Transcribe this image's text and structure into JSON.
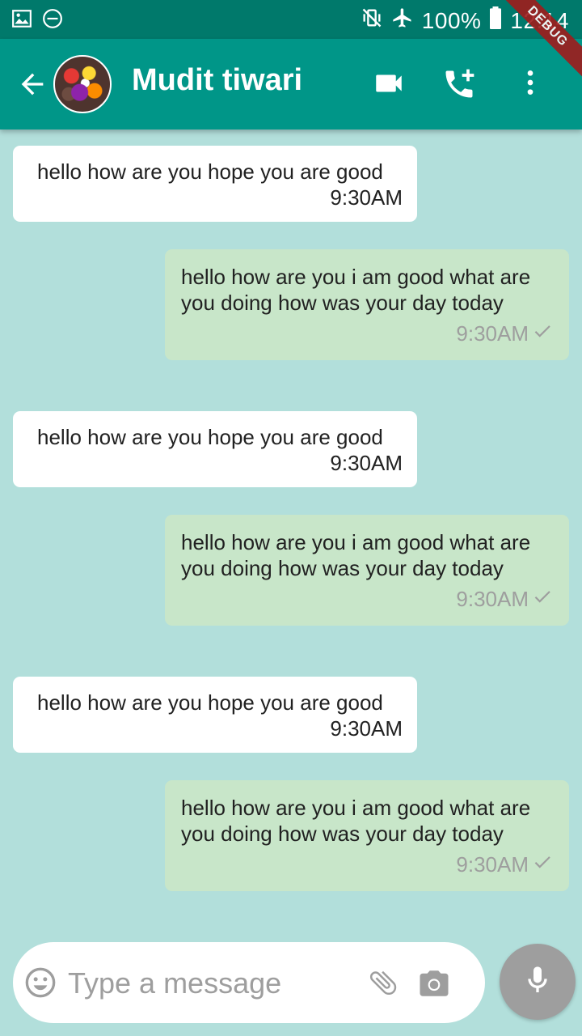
{
  "status_bar": {
    "battery_text": "100%",
    "time": "12:14",
    "icons": [
      "image-icon",
      "do-not-disturb-icon",
      "mute-vibrate-icon",
      "airplane-icon",
      "battery-icon"
    ]
  },
  "debug_banner": "DEBUG",
  "app_bar": {
    "contact_name": "Mudit tiwari",
    "icons": [
      "back-arrow-icon",
      "video-call-icon",
      "add-call-icon",
      "more-vert-icon"
    ]
  },
  "messages": [
    {
      "direction": "incoming",
      "text": "hello how are you hope you are good",
      "time": "9:30AM"
    },
    {
      "direction": "outgoing",
      "text": "hello how are you i am good what are you doing how was your day today",
      "time": "9:30AM",
      "status": "sent"
    },
    {
      "direction": "incoming",
      "text": "hello how are you hope you are good",
      "time": "9:30AM"
    },
    {
      "direction": "outgoing",
      "text": "hello how are you i am good what are you doing how was your day today",
      "time": "9:30AM",
      "status": "sent"
    },
    {
      "direction": "incoming",
      "text": "hello how are you hope you are good",
      "time": "9:30AM"
    },
    {
      "direction": "outgoing",
      "text": "hello how are you i am good what are you doing how was your day today",
      "time": "9:30AM",
      "status": "sent"
    }
  ],
  "composer": {
    "placeholder": "Type a message",
    "icons": [
      "emoji-icon",
      "attach-icon",
      "camera-icon",
      "mic-icon"
    ]
  },
  "colors": {
    "status_bar": "#00796b",
    "app_bar": "#009688",
    "chat_background": "#b2dfdb",
    "incoming_bubble": "#ffffff",
    "outgoing_bubble": "#c8e6c9",
    "mic_button": "#9e9e9e"
  }
}
